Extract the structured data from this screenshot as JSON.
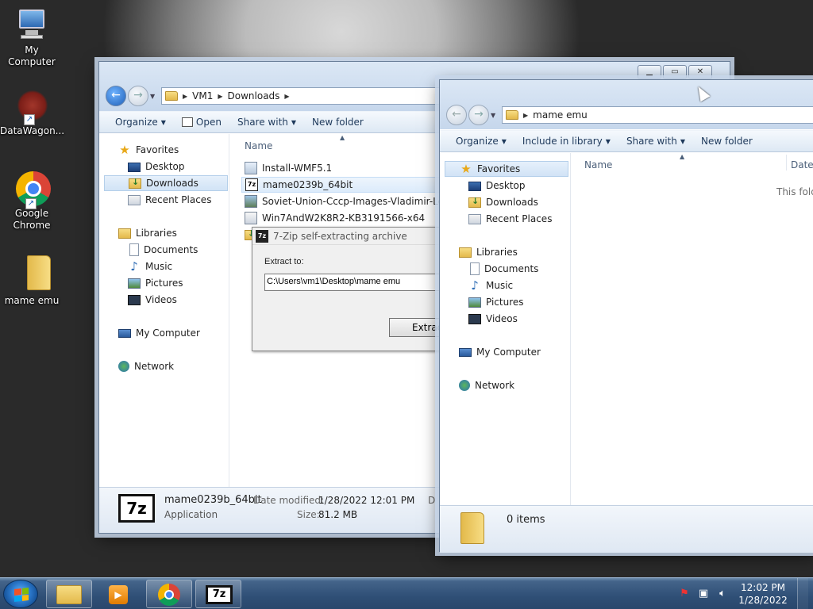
{
  "desktop": {
    "icons": [
      {
        "label": "My Computer",
        "icon": "computer-icon"
      },
      {
        "label": "DataWagon...",
        "icon": "datawagon-icon"
      },
      {
        "label": "Google Chrome",
        "icon": "chrome-icon"
      },
      {
        "label": "mame emu",
        "icon": "folder-icon"
      }
    ]
  },
  "explorer_downloads": {
    "breadcrumb": [
      "VM1",
      "Downloads"
    ],
    "toolbar": {
      "organize": "Organize",
      "open": "Open",
      "share_with": "Share with",
      "new_folder": "New folder"
    },
    "nav": {
      "favorites": "Favorites",
      "desktop": "Desktop",
      "downloads": "Downloads",
      "recent": "Recent Places",
      "libraries": "Libraries",
      "documents": "Documents",
      "music": "Music",
      "pictures": "Pictures",
      "videos": "Videos",
      "my_computer": "My Computer",
      "network": "Network"
    },
    "column_name": "Name",
    "files": [
      {
        "name": "Install-WMF5.1",
        "icon": "setup-icon"
      },
      {
        "name": "mame0239b_64bit",
        "icon": "7zip-icon"
      },
      {
        "name": "Soviet-Union-Cccp-Images-Vladimir-Len...",
        "icon": "image-icon"
      },
      {
        "name": "Win7AndW2K8R2-KB3191566-x64",
        "icon": "msu-icon"
      }
    ],
    "details": {
      "name": "mame0239b_64bit",
      "type": "Application",
      "date_label": "Date modified:",
      "date_value": "1/28/2022 12:01 PM",
      "size_label": "Size:",
      "size_value": "81.2 MB",
      "extra": "D"
    }
  },
  "sevenzip_dialog": {
    "title": "7-Zip self-extracting archive",
    "extract_label": "Extract to:",
    "path_value": "C:\\Users\\vm1\\Desktop\\mame emu",
    "extract_button": "Extract"
  },
  "explorer_mame": {
    "breadcrumb": [
      "mame emu"
    ],
    "toolbar": {
      "organize": "Organize",
      "include_library": "Include in library",
      "share_with": "Share with",
      "new_folder": "New folder"
    },
    "nav": {
      "favorites": "Favorites",
      "desktop": "Desktop",
      "downloads": "Downloads",
      "recent": "Recent Places",
      "libraries": "Libraries",
      "documents": "Documents",
      "music": "Music",
      "pictures": "Pictures",
      "videos": "Videos",
      "my_computer": "My Computer",
      "network": "Network"
    },
    "column_name": "Name",
    "column_date": "Date",
    "empty_text": "This fold",
    "items_count": "0 items"
  },
  "taskbar": {
    "time": "12:02 PM",
    "date": "1/28/2022"
  }
}
